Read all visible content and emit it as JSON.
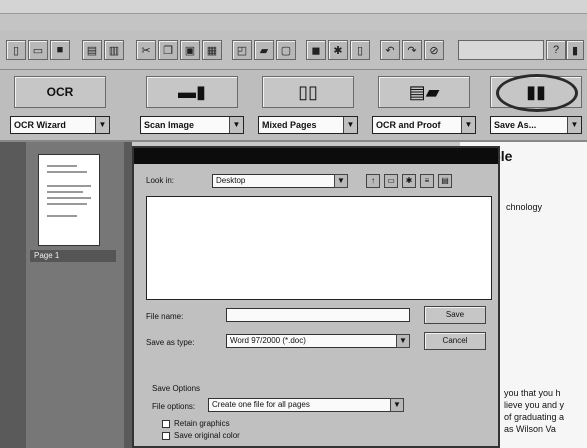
{
  "toolbar2": {
    "btn1_label": "OCR",
    "combo1": "OCR Wizard",
    "combo2": "Scan Image",
    "combo3": "Mixed Pages",
    "combo4": "OCR and Proof",
    "combo5": "Save As..."
  },
  "thumbnail": {
    "label": "Page 1"
  },
  "dialog": {
    "look_in_label": "Look in:",
    "look_in_value": "Desktop",
    "filename_label": "File name:",
    "filename_value": "",
    "save_type_label": "Save as type:",
    "save_type_value": "Word 97/2000 (*.doc)",
    "save_button": "Save",
    "cancel_button": "Cancel",
    "save_options_label": "Save Options",
    "file_options_label": "File options:",
    "file_options_value": "Create one file for all pages",
    "check1": "Retain graphics",
    "check2": "Save original color"
  },
  "document": {
    "heading": "ample",
    "line1": "chnology",
    "text1": "you that you h",
    "text2": "lieve you and y",
    "text3": "of graduating a",
    "text4": "as Wilson Va"
  }
}
